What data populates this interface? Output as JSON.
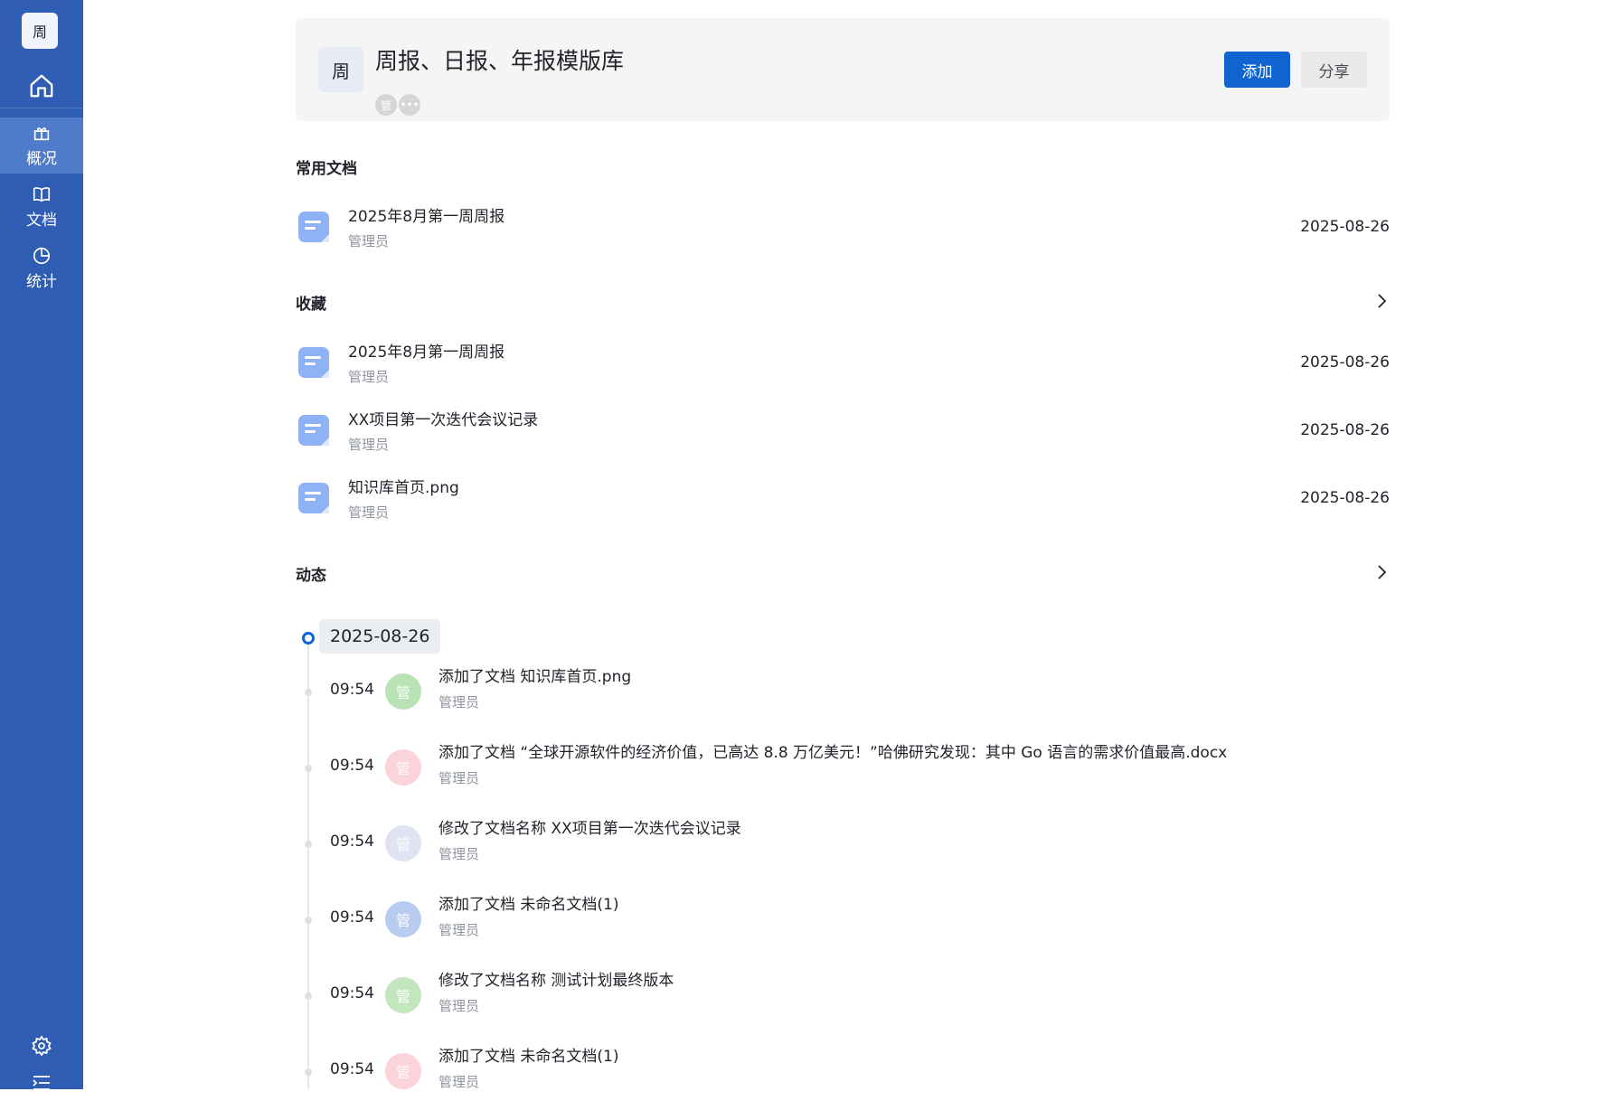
{
  "sidebar": {
    "logo_text": "周",
    "items": [
      {
        "label": "概况",
        "icon": "gift-icon",
        "active": true
      },
      {
        "label": "文档",
        "icon": "book-icon",
        "active": false
      },
      {
        "label": "统计",
        "icon": "pie-chart-icon",
        "active": false
      }
    ],
    "accent": "#2f5db4"
  },
  "header": {
    "avatar_text": "周",
    "title": "周报、日报、年报模版库",
    "member_avatar": "管",
    "add_label": "添加",
    "share_label": "分享"
  },
  "frequent": {
    "title": "常用文档",
    "docs": [
      {
        "name": "2025年8月第一周周报",
        "owner": "管理员",
        "date": "2025-08-26"
      }
    ]
  },
  "favorites": {
    "title": "收藏",
    "docs": [
      {
        "name": "2025年8月第一周周报",
        "owner": "管理员",
        "date": "2025-08-26"
      },
      {
        "name": "XX项目第一次迭代会议记录",
        "owner": "管理员",
        "date": "2025-08-26"
      },
      {
        "name": "知识库首页.png",
        "owner": "管理员",
        "date": "2025-08-26"
      }
    ]
  },
  "activity": {
    "title": "动态",
    "date": "2025-08-26",
    "items": [
      {
        "time": "09:54",
        "avatar": "管",
        "color": "#b9e3b5",
        "text": "添加了文档 知识库首页.png",
        "user": "管理员"
      },
      {
        "time": "09:54",
        "avatar": "管",
        "color": "#fbd3d8",
        "text": "添加了文档 “全球开源软件的经济价值，已高达 8.8 万亿美元！”哈佛研究发现：其中 Go 语言的需求价值最高.docx",
        "user": "管理员"
      },
      {
        "time": "09:54",
        "avatar": "管",
        "color": "#dfe3f2",
        "text": "修改了文档名称 XX项目第一次迭代会议记录",
        "user": "管理员"
      },
      {
        "time": "09:54",
        "avatar": "管",
        "color": "#b7ccef",
        "text": "添加了文档 未命名文档(1)",
        "user": "管理员"
      },
      {
        "time": "09:54",
        "avatar": "管",
        "color": "#c4e6bf",
        "text": "修改了文档名称 测试计划最终版本",
        "user": "管理员"
      },
      {
        "time": "09:54",
        "avatar": "管",
        "color": "#fbd3d8",
        "text": "添加了文档 未命名文档(1)",
        "user": "管理员"
      }
    ]
  }
}
